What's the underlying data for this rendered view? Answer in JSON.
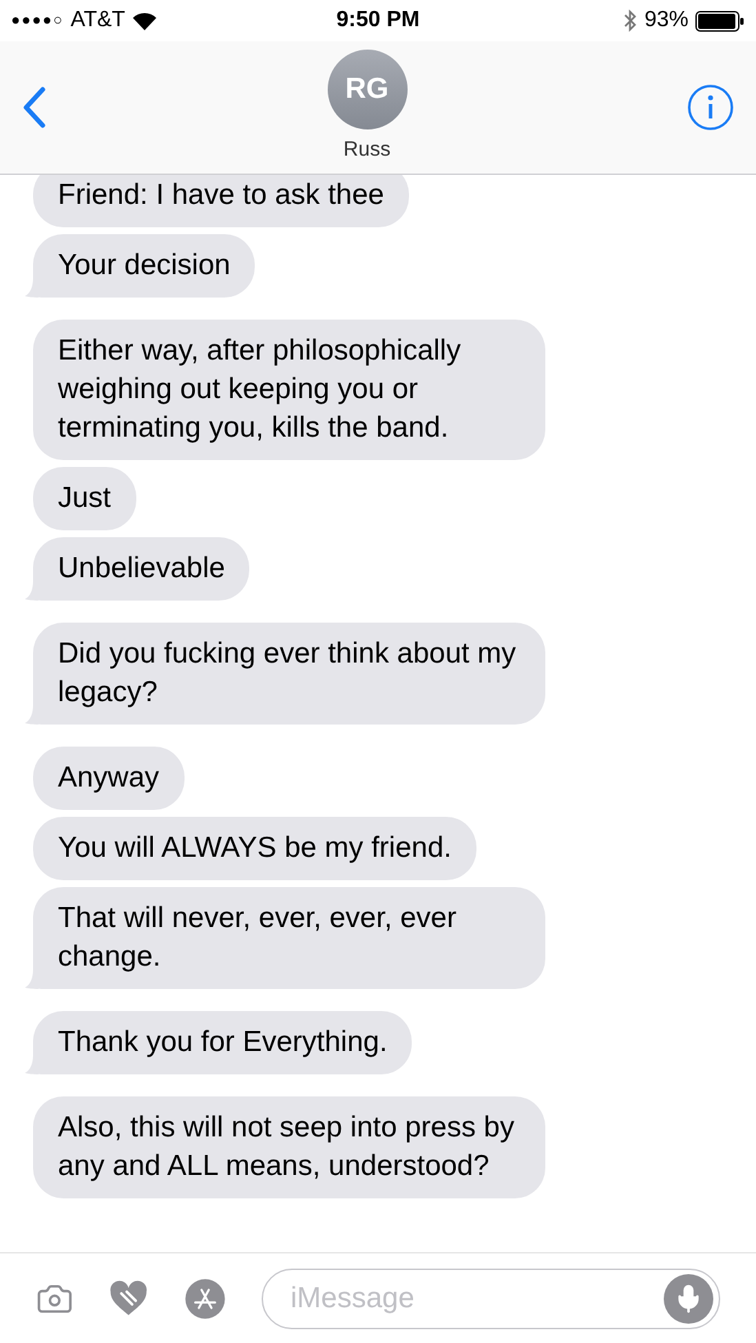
{
  "status_bar": {
    "signal": "●●●●○",
    "carrier": "AT&T",
    "time": "9:50 PM",
    "battery": "93%"
  },
  "header": {
    "initials": "RG",
    "name": "Russ"
  },
  "messages": [
    {
      "text": "Friend: I have to ask thee",
      "tail": false
    },
    {
      "text": "Your decision",
      "tail": true
    },
    {
      "text": "Either way, after philosophically weighing out keeping you or terminating you, kills the band.",
      "tail": false
    },
    {
      "text": "Just",
      "tail": false
    },
    {
      "text": "Unbelievable",
      "tail": true
    },
    {
      "text": "Did you fucking ever think about my legacy?",
      "tail": true
    },
    {
      "text": "Anyway",
      "tail": false
    },
    {
      "text": "You will ALWAYS be my friend.",
      "tail": false
    },
    {
      "text": "That will never, ever, ever, ever change.",
      "tail": true
    },
    {
      "text": "Thank you for Everything.",
      "tail": true
    },
    {
      "text": "Also, this will not seep into press by any and ALL means, understood?",
      "tail": false
    }
  ],
  "compose": {
    "placeholder": "iMessage"
  }
}
